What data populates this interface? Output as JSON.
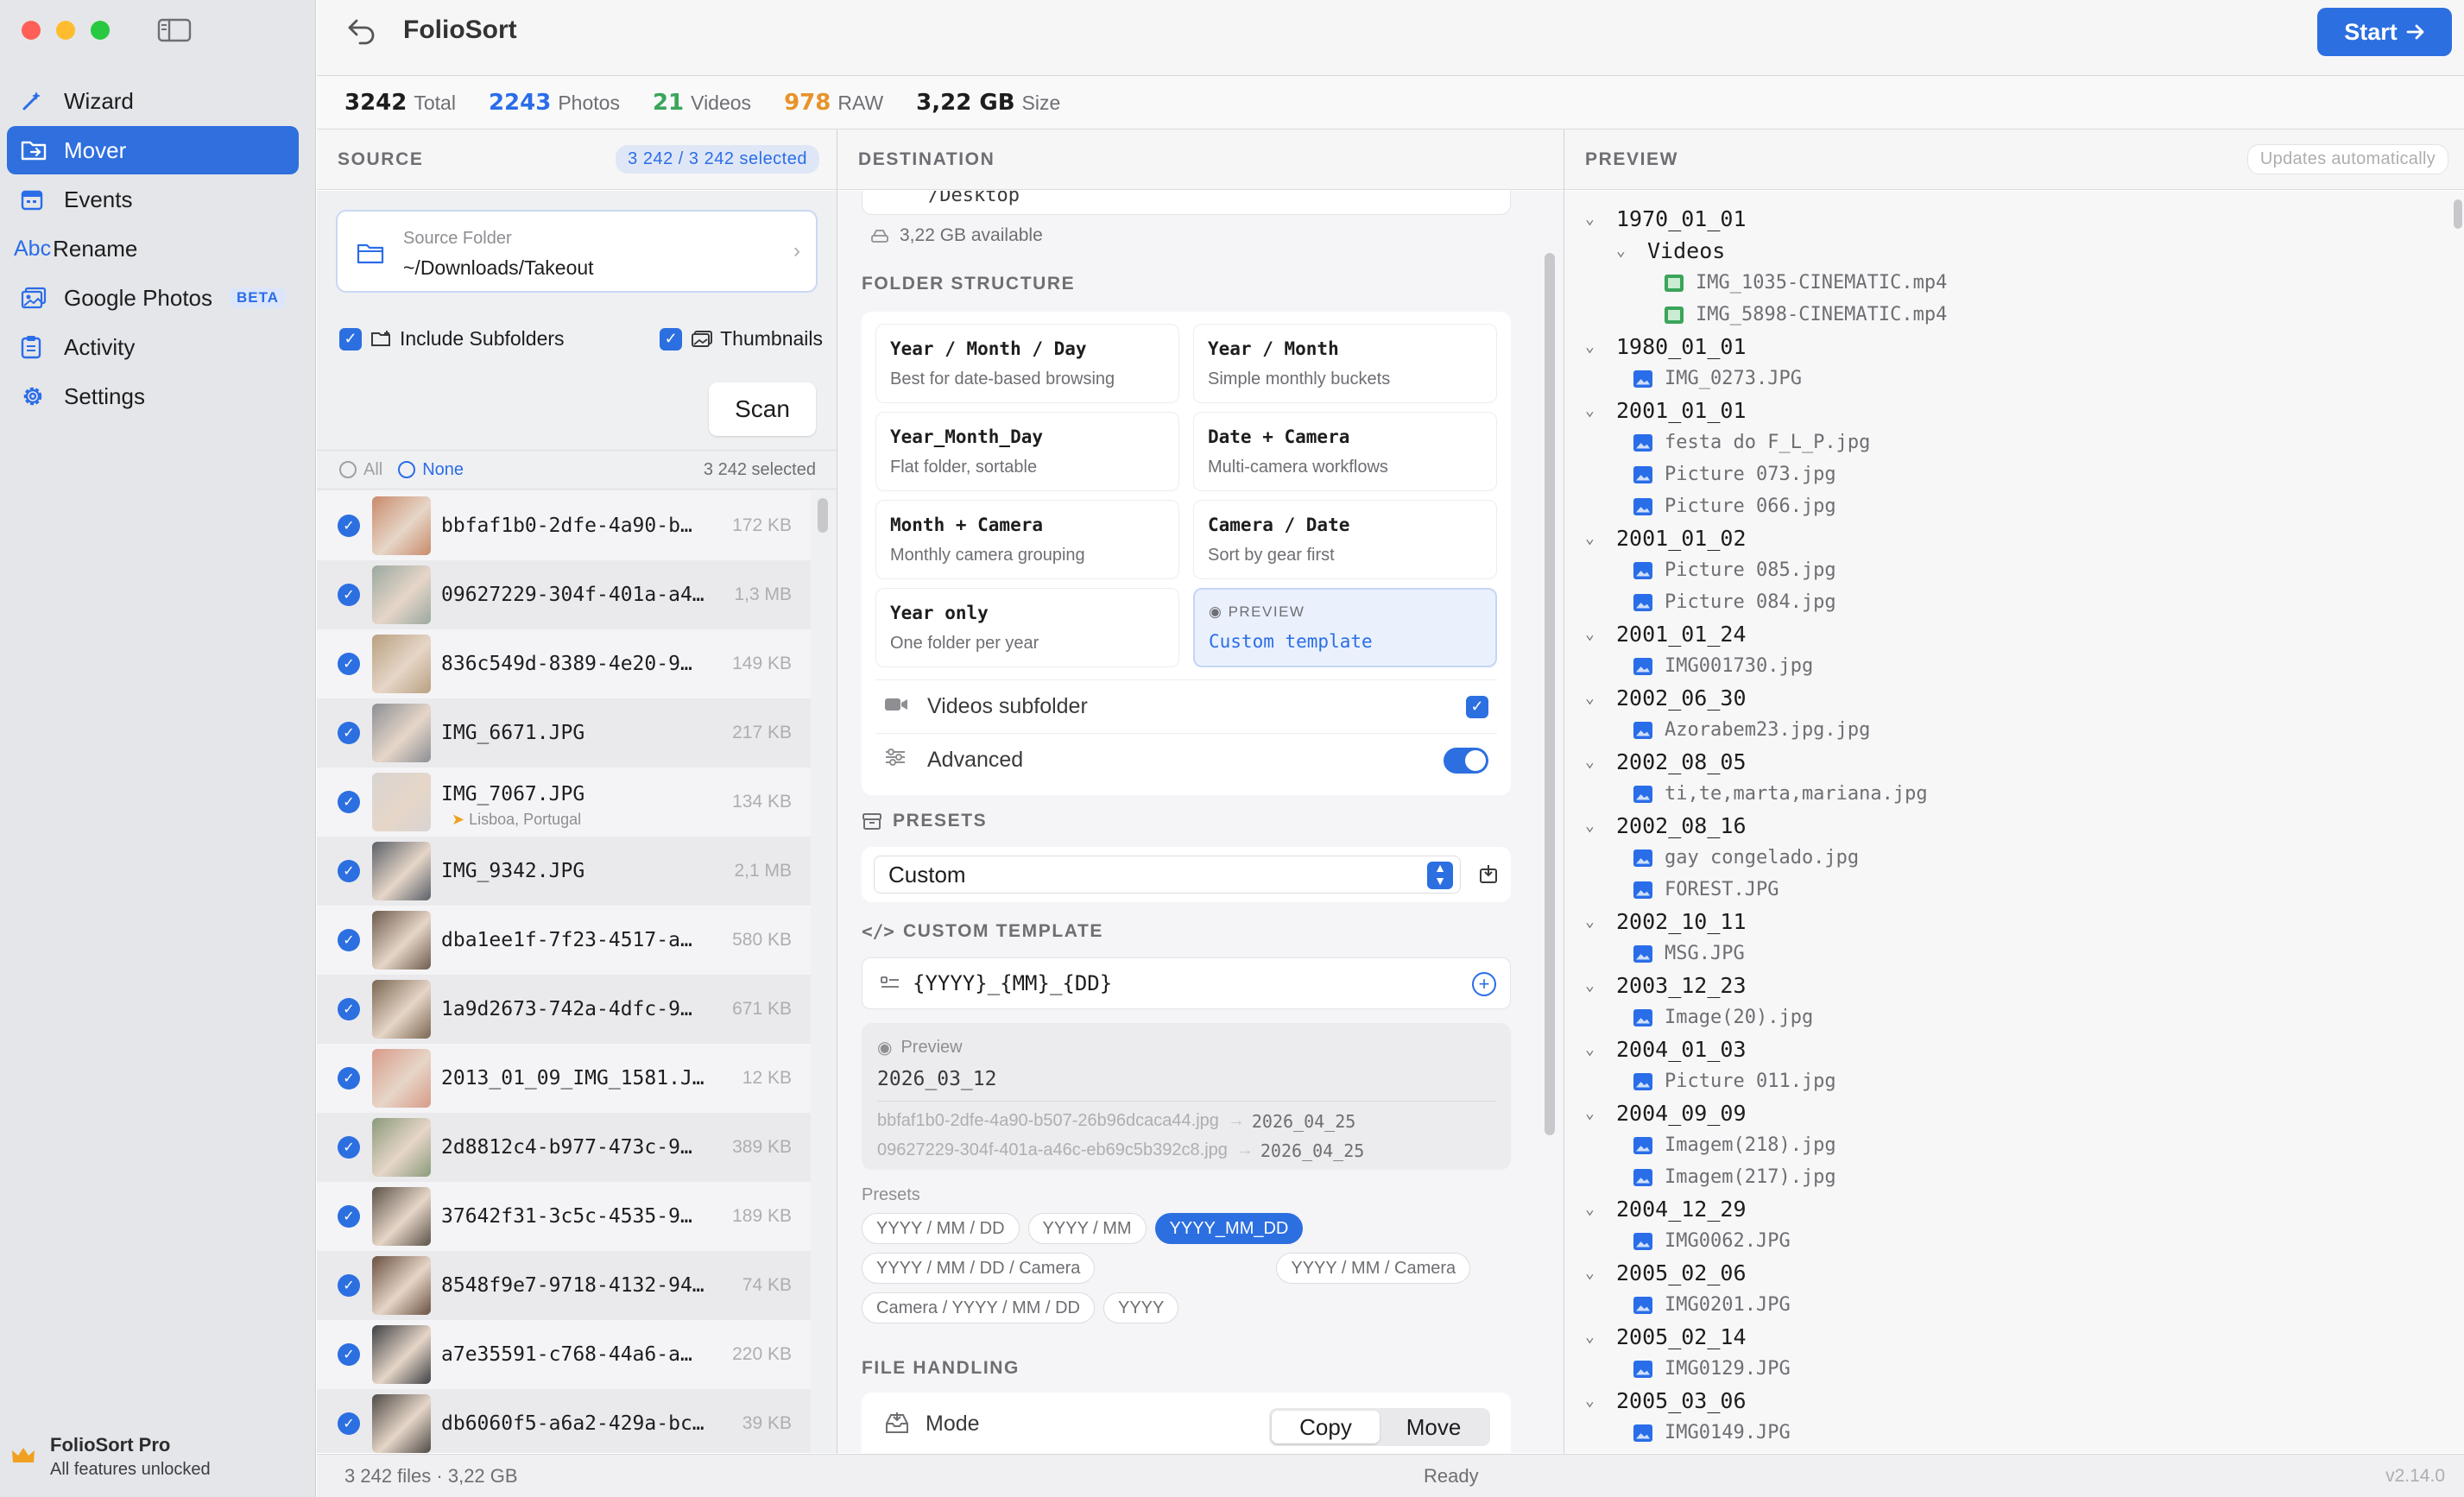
{
  "sidebar": {
    "items": [
      {
        "label": "Wizard",
        "icon": "wand-icon"
      },
      {
        "label": "Mover",
        "icon": "folder-move-icon",
        "active": true
      },
      {
        "label": "Events",
        "icon": "calendar-icon"
      },
      {
        "label": "Rename",
        "icon": "abc-icon",
        "icon_text": "Abc"
      },
      {
        "label": "Google Photos",
        "icon": "photos-icon",
        "badge": "BETA"
      },
      {
        "label": "Activity",
        "icon": "clipboard-icon"
      },
      {
        "label": "Settings",
        "icon": "gear-icon"
      }
    ],
    "pro_title": "FolioSort Pro",
    "pro_subtitle": "All features unlocked"
  },
  "titlebar": {
    "title": "FolioSort",
    "start_label": "Start"
  },
  "stats": {
    "total": "3242",
    "total_label": "Total",
    "photos": "2243",
    "photos_label": "Photos",
    "videos": "21",
    "videos_label": "Videos",
    "raw": "978",
    "raw_label": "RAW",
    "size": "3,22 GB",
    "size_label": "Size",
    "colors": {
      "photos": "#2a6de8",
      "videos": "#3aa55a",
      "raw": "#e8932a"
    }
  },
  "source": {
    "heading": "SOURCE",
    "selected_pill": "3 242 / 3 242 selected",
    "folder_label": "Source Folder",
    "folder_path": "~/Downloads/Takeout",
    "include_subfolders": "Include Subfolders",
    "thumbnails": "Thumbnails",
    "scan_label": "Scan",
    "all_label": "All",
    "none_label": "None",
    "selected_count": "3 242 selected",
    "files": [
      {
        "name": "bbfaf1b0-2dfe-4a90-b…",
        "size": "172 KB",
        "thumb": "#c98a6a"
      },
      {
        "name": "09627229-304f-401a-a4…",
        "size": "1,3 MB",
        "thumb": "#9aa8a0"
      },
      {
        "name": "836c549d-8389-4e20-9…",
        "size": "149 KB",
        "thumb": "#b8a080"
      },
      {
        "name": "IMG_6671.JPG",
        "size": "217 KB",
        "thumb": "#8c8f94"
      },
      {
        "name": "IMG_7067.JPG",
        "size": "134 KB",
        "thumb": "#d8d4d2",
        "location": "Lisboa, Portugal"
      },
      {
        "name": "IMG_9342.JPG",
        "size": "2,1 MB",
        "thumb": "#5a6068"
      },
      {
        "name": "dba1ee1f-7f23-4517-a…",
        "size": "580 KB",
        "thumb": "#6e5c4e"
      },
      {
        "name": "1a9d2673-742a-4dfc-9…",
        "size": "671 KB",
        "thumb": "#7a6650"
      },
      {
        "name": "2013_01_09_IMG_1581.J…",
        "size": "12 KB",
        "thumb": "#d89a88"
      },
      {
        "name": "2d8812c4-b977-473c-9…",
        "size": "389 KB",
        "thumb": "#8a9a7a"
      },
      {
        "name": "37642f31-3c5c-4535-9…",
        "size": "189 KB",
        "thumb": "#5c5248"
      },
      {
        "name": "8548f9e7-9718-4132-94…",
        "size": "74 KB",
        "thumb": "#6a5040"
      },
      {
        "name": "a7e35591-c768-44a6-a…",
        "size": "220 KB",
        "thumb": "#3e4044"
      },
      {
        "name": "db6060f5-a6a2-429a-bc…",
        "size": "39 KB",
        "thumb": "#4e4a46"
      }
    ]
  },
  "destination": {
    "heading": "DESTINATION",
    "top_partial_text": "/Desktop",
    "available": "3,22 GB available",
    "folder_structure_title": "FOLDER STRUCTURE",
    "structures": [
      {
        "title": "Year / Month / Day",
        "desc": "Best for date-based browsing"
      },
      {
        "title": "Year / Month",
        "desc": "Simple monthly buckets"
      },
      {
        "title": "Year_Month_Day",
        "desc": "Flat folder, sortable"
      },
      {
        "title": "Date + Camera",
        "desc": "Multi-camera workflows"
      },
      {
        "title": "Month + Camera",
        "desc": "Monthly camera grouping"
      },
      {
        "title": "Camera / Date",
        "desc": "Sort by gear first"
      },
      {
        "title": "Year only",
        "desc": "One folder per year"
      }
    ],
    "custom_card": {
      "preview_label": "PREVIEW",
      "title": "Custom template"
    },
    "videos_subfolder": "Videos subfolder",
    "advanced": "Advanced",
    "presets_title": "PRESETS",
    "preset_value": "Custom",
    "custom_template_title": "CUSTOM TEMPLATE",
    "template_value": "{YYYY}_{MM}_{DD}",
    "preview_label": "Preview",
    "preview_date": "2026_03_12",
    "examples": [
      {
        "from": "bbfaf1b0-2dfe-4a90-b507-26b96dcaca44.jpg",
        "to": "2026_04_25"
      },
      {
        "from": "09627229-304f-401a-a46c-eb69c5b392c8.jpg",
        "to": "2026_04_25"
      }
    ],
    "chips_label": "Presets",
    "chips": [
      {
        "label": "YYYY / MM / DD"
      },
      {
        "label": "YYYY / MM"
      },
      {
        "label": "YYYY_MM_DD",
        "selected": true
      },
      {
        "label": "YYYY / MM / DD / Camera"
      },
      {
        "label": "YYYY / MM / Camera"
      },
      {
        "label": "Camera / YYYY / MM / DD"
      },
      {
        "label": "YYYY"
      }
    ],
    "file_handling_title": "FILE HANDLING",
    "mode_label": "Mode",
    "copy_label": "Copy",
    "move_label": "Move"
  },
  "preview": {
    "heading": "PREVIEW",
    "auto_pill": "Updates automatically",
    "tree": [
      {
        "t": "d0",
        "label": "1970_01_01"
      },
      {
        "t": "d1",
        "label": "Videos"
      },
      {
        "t": "fv2",
        "label": "IMG_1035-CINEMATIC.mp4"
      },
      {
        "t": "fv2",
        "label": "IMG_5898-CINEMATIC.mp4"
      },
      {
        "t": "d0",
        "label": "1980_01_01"
      },
      {
        "t": "f1",
        "label": "IMG_0273.JPG"
      },
      {
        "t": "d0",
        "label": "2001_01_01"
      },
      {
        "t": "f1",
        "label": "festa do F_L_P.jpg"
      },
      {
        "t": "f1",
        "label": "Picture 073.jpg"
      },
      {
        "t": "f1",
        "label": "Picture 066.jpg"
      },
      {
        "t": "d0",
        "label": "2001_01_02"
      },
      {
        "t": "f1",
        "label": "Picture 085.jpg"
      },
      {
        "t": "f1",
        "label": "Picture 084.jpg"
      },
      {
        "t": "d0",
        "label": "2001_01_24"
      },
      {
        "t": "f1",
        "label": "IMG001730.jpg"
      },
      {
        "t": "d0",
        "label": "2002_06_30"
      },
      {
        "t": "f1",
        "label": "Azorabem23.jpg.jpg"
      },
      {
        "t": "d0",
        "label": "2002_08_05"
      },
      {
        "t": "f1",
        "label": "ti,te,marta,mariana.jpg"
      },
      {
        "t": "d0",
        "label": "2002_08_16"
      },
      {
        "t": "f1",
        "label": "gay congelado.jpg"
      },
      {
        "t": "f1",
        "label": "FOREST.JPG"
      },
      {
        "t": "d0",
        "label": "2002_10_11"
      },
      {
        "t": "f1",
        "label": "MSG.JPG"
      },
      {
        "t": "d0",
        "label": "2003_12_23"
      },
      {
        "t": "f1",
        "label": "Image(20).jpg"
      },
      {
        "t": "d0",
        "label": "2004_01_03"
      },
      {
        "t": "f1",
        "label": "Picture 011.jpg"
      },
      {
        "t": "d0",
        "label": "2004_09_09"
      },
      {
        "t": "f1",
        "label": "Imagem(218).jpg"
      },
      {
        "t": "f1",
        "label": "Imagem(217).jpg"
      },
      {
        "t": "d0",
        "label": "2004_12_29"
      },
      {
        "t": "f1",
        "label": "IMG0062.JPG"
      },
      {
        "t": "d0",
        "label": "2005_02_06"
      },
      {
        "t": "f1",
        "label": "IMG0201.JPG"
      },
      {
        "t": "d0",
        "label": "2005_02_14"
      },
      {
        "t": "f1",
        "label": "IMG0129.JPG"
      },
      {
        "t": "d0",
        "label": "2005_03_06"
      },
      {
        "t": "f1",
        "label": "IMG0149.JPG"
      }
    ]
  },
  "status": {
    "summary": "3 242 files · 3,22 GB",
    "state": "Ready",
    "version": "v2.14.0"
  }
}
